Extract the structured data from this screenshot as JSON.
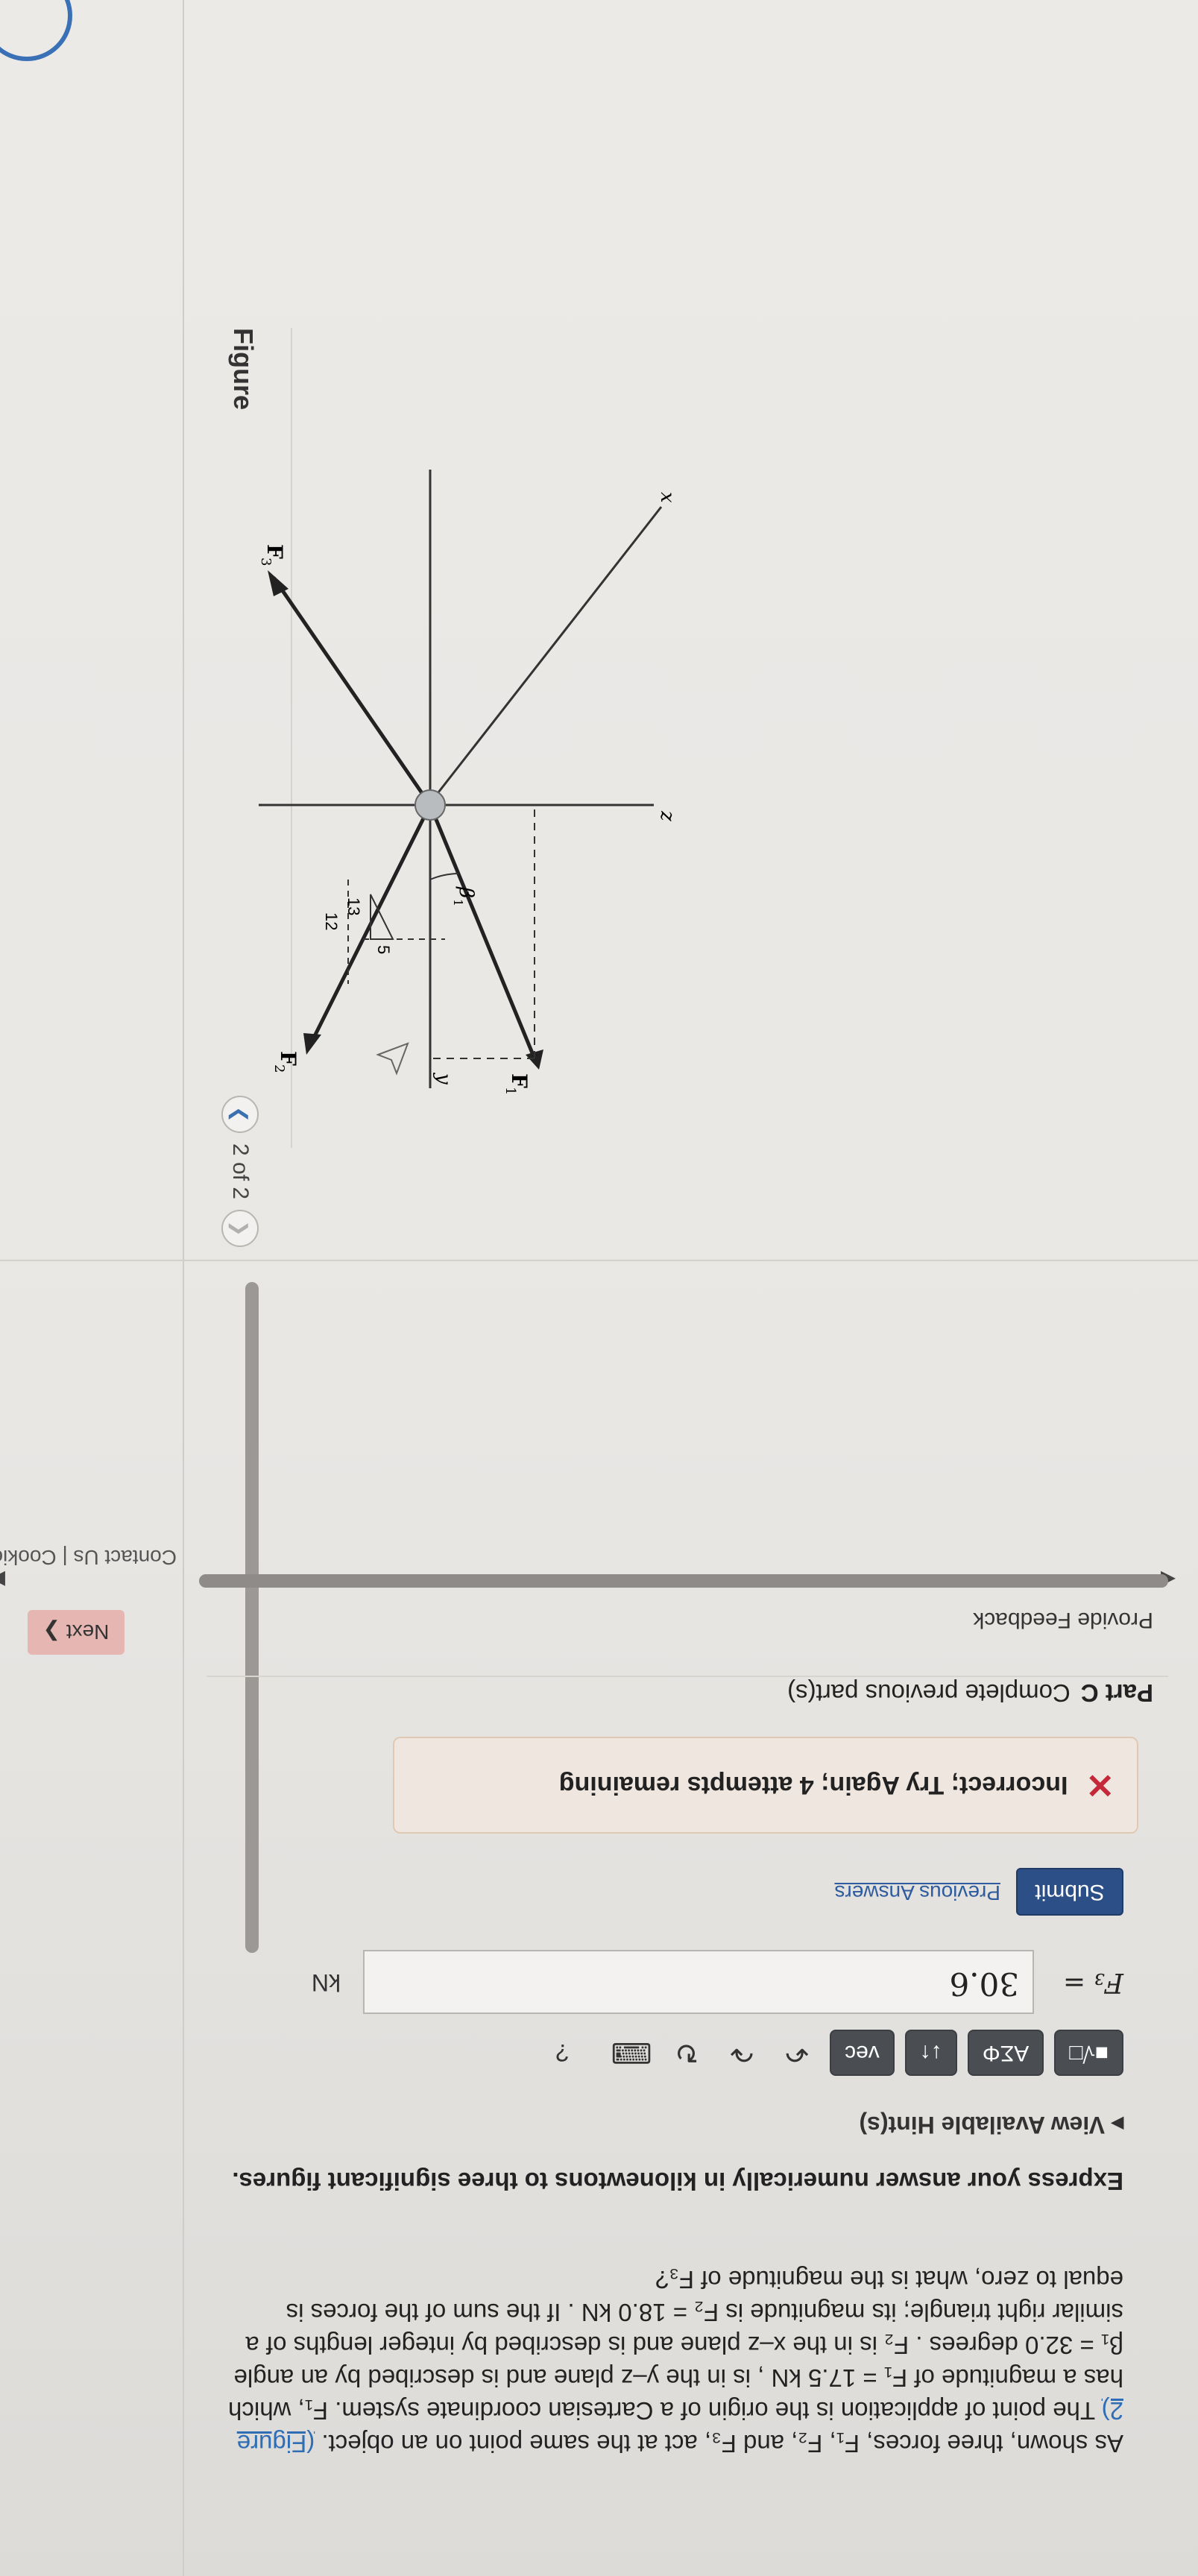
{
  "figure": {
    "title": "Figure",
    "pager_text": "2 of 2",
    "prev_icon": "chevron-left-icon",
    "next_icon": "chevron-right-icon",
    "labels": {
      "z": "z",
      "x": "x",
      "y": "y",
      "F1": "F",
      "F1_sub": "1",
      "F2": "F",
      "F2_sub": "2",
      "F3": "F",
      "F3_sub": "3",
      "beta": "β",
      "beta_sub": "1",
      "tri_13": "13",
      "tri_12": "12",
      "tri_5": "5"
    }
  },
  "problem": {
    "line1": "As shown, three forces, F",
    "text_before_link": "As shown, three forces, F₁, F₂, and F₃, act at the same point on an object. ",
    "link": "(Figure 2)",
    "text_after_link": " The point of application is the origin of a Cartesian coordinate system. F₁, which has a magnitude of F₁ = 17.5 kN , is in the y–z plane and is described by an angle β₁ = 32.0 degrees . F₂ is in the x–z plane and is described by integer lengths of a similar right triangle; its magnitude is F₂ = 18.0 kN . If the sum of the forces is equal to zero, what is the magnitude of F₃?",
    "instruction": "Express your answer numerically in kilonewtons to three significant figures.",
    "hints": "View Available Hint(s)"
  },
  "toolbar": {
    "templates_icon": "templates-icon",
    "greek": "ΑΣΦ",
    "arrows": "↓↑",
    "vec": "vec",
    "undo_icon": "undo-icon",
    "redo_icon": "redo-icon",
    "reset_icon": "reset-icon",
    "keyboard_icon": "keyboard-icon",
    "help": "?"
  },
  "answer": {
    "label": "F₃ =",
    "value": "30.6",
    "unit": "kN"
  },
  "actions": {
    "submit": "Submit",
    "previous": "Previous Answers"
  },
  "feedback": {
    "text": "Incorrect; Try Again; 4 attempts remaining"
  },
  "partc": {
    "label": "Part C",
    "text": "Complete previous part(s)"
  },
  "footer": {
    "provide": "Provide Feedback",
    "next": "Next ❯",
    "cookie": "Contact Us | Cookie Settings |"
  },
  "colors": {
    "submit_bg": "#2b4f86",
    "error": "#c4283a",
    "link": "#2f6db5"
  }
}
